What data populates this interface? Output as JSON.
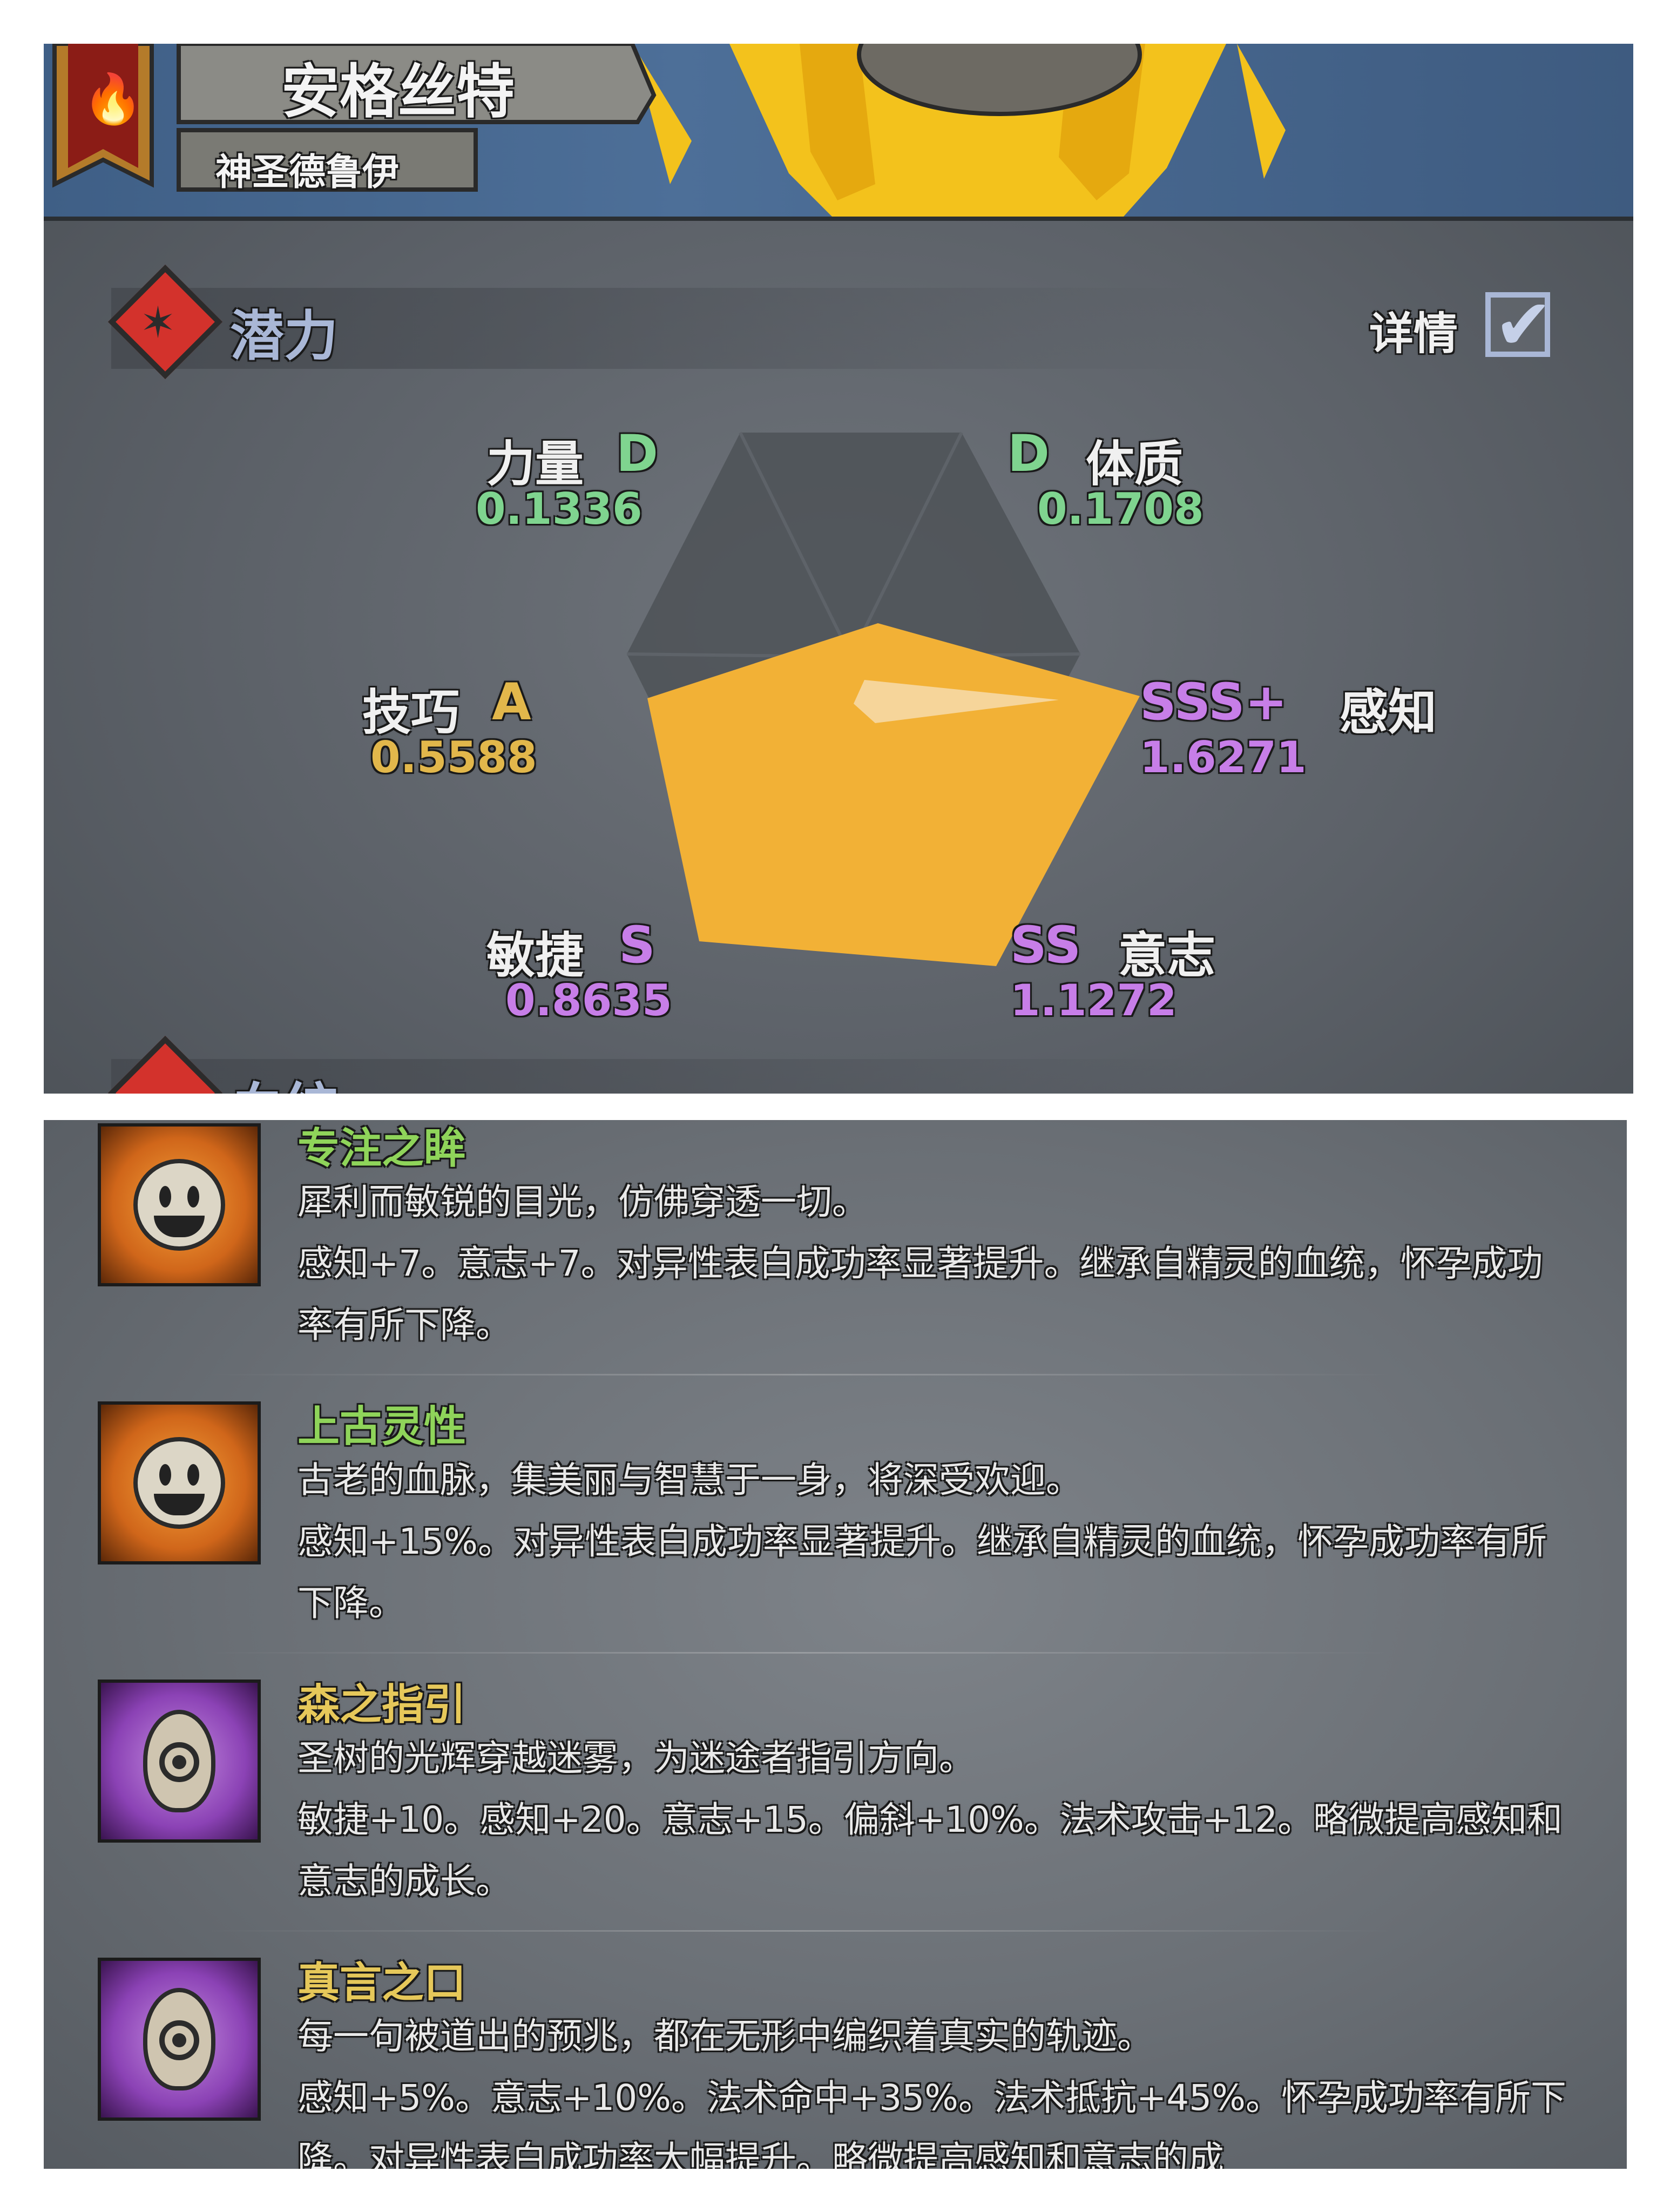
{
  "header": {
    "character_name": "安格丝特",
    "character_class": "神圣德鲁伊"
  },
  "potential": {
    "title": "潜力",
    "details_label": "详情",
    "details_checked": true,
    "stats": {
      "strength": {
        "name": "力量",
        "grade": "D",
        "value": "0.1336",
        "color": "#7fd48f"
      },
      "constitution": {
        "name": "体质",
        "grade": "D",
        "value": "0.1708",
        "color": "#7fd48f"
      },
      "skill": {
        "name": "技巧",
        "grade": "A",
        "value": "0.5588",
        "color": "#e2b74b"
      },
      "perception": {
        "name": "感知",
        "grade": "SSS+",
        "value": "1.6271",
        "color": "#c77ee8"
      },
      "agility": {
        "name": "敏捷",
        "grade": "S",
        "value": "0.8635",
        "color": "#c77ee8"
      },
      "will": {
        "name": "意志",
        "grade": "SS",
        "value": "1.1272",
        "color": "#c77ee8"
      }
    }
  },
  "bloodline": {
    "title_partial": "血统"
  },
  "skills": [
    {
      "name": "专注之眸",
      "name_color": "#8fd45a",
      "icon": "smiley-face-icon",
      "flavor": "犀利而敏锐的目光，仿佛穿透一切。",
      "effect": "感知+7。意志+7。对异性表白成功率显著提升。继承自精灵的血统，怀孕成功率有所下降。"
    },
    {
      "name": "上古灵性",
      "name_color": "#8fd45a",
      "icon": "smiley-face-icon",
      "flavor": "古老的血脉，集美丽与智慧于一身，将深受欢迎。",
      "effect": "感知+15%。对异性表白成功率显著提升。继承自精灵的血统，怀孕成功率有所下降。"
    },
    {
      "name": "森之指引",
      "name_color": "#e6c85a",
      "icon": "spiral-emblem-icon",
      "flavor": "圣树的光辉穿越迷雾，为迷途者指引方向。",
      "effect": "敏捷+10。感知+20。意志+15。偏斜+10%。法术攻击+12。略微提高感知和意志的成长。"
    },
    {
      "name": "真言之口",
      "name_color": "#e6c85a",
      "icon": "spiral-emblem-icon",
      "flavor": "每一句被道出的预兆，都在无形中编织着真实的轨迹。",
      "effect": "感知+5%。意志+10%。法术命中+35%。法术抵抗+45%。怀孕成功率有所下降。对异性表白成功率大幅提升。略微提高感知和意志的成"
    }
  ],
  "colors": {
    "radar_fill": "#f2b136",
    "panel_bg": "#5f646a",
    "title_text": "#a9b7d6"
  }
}
